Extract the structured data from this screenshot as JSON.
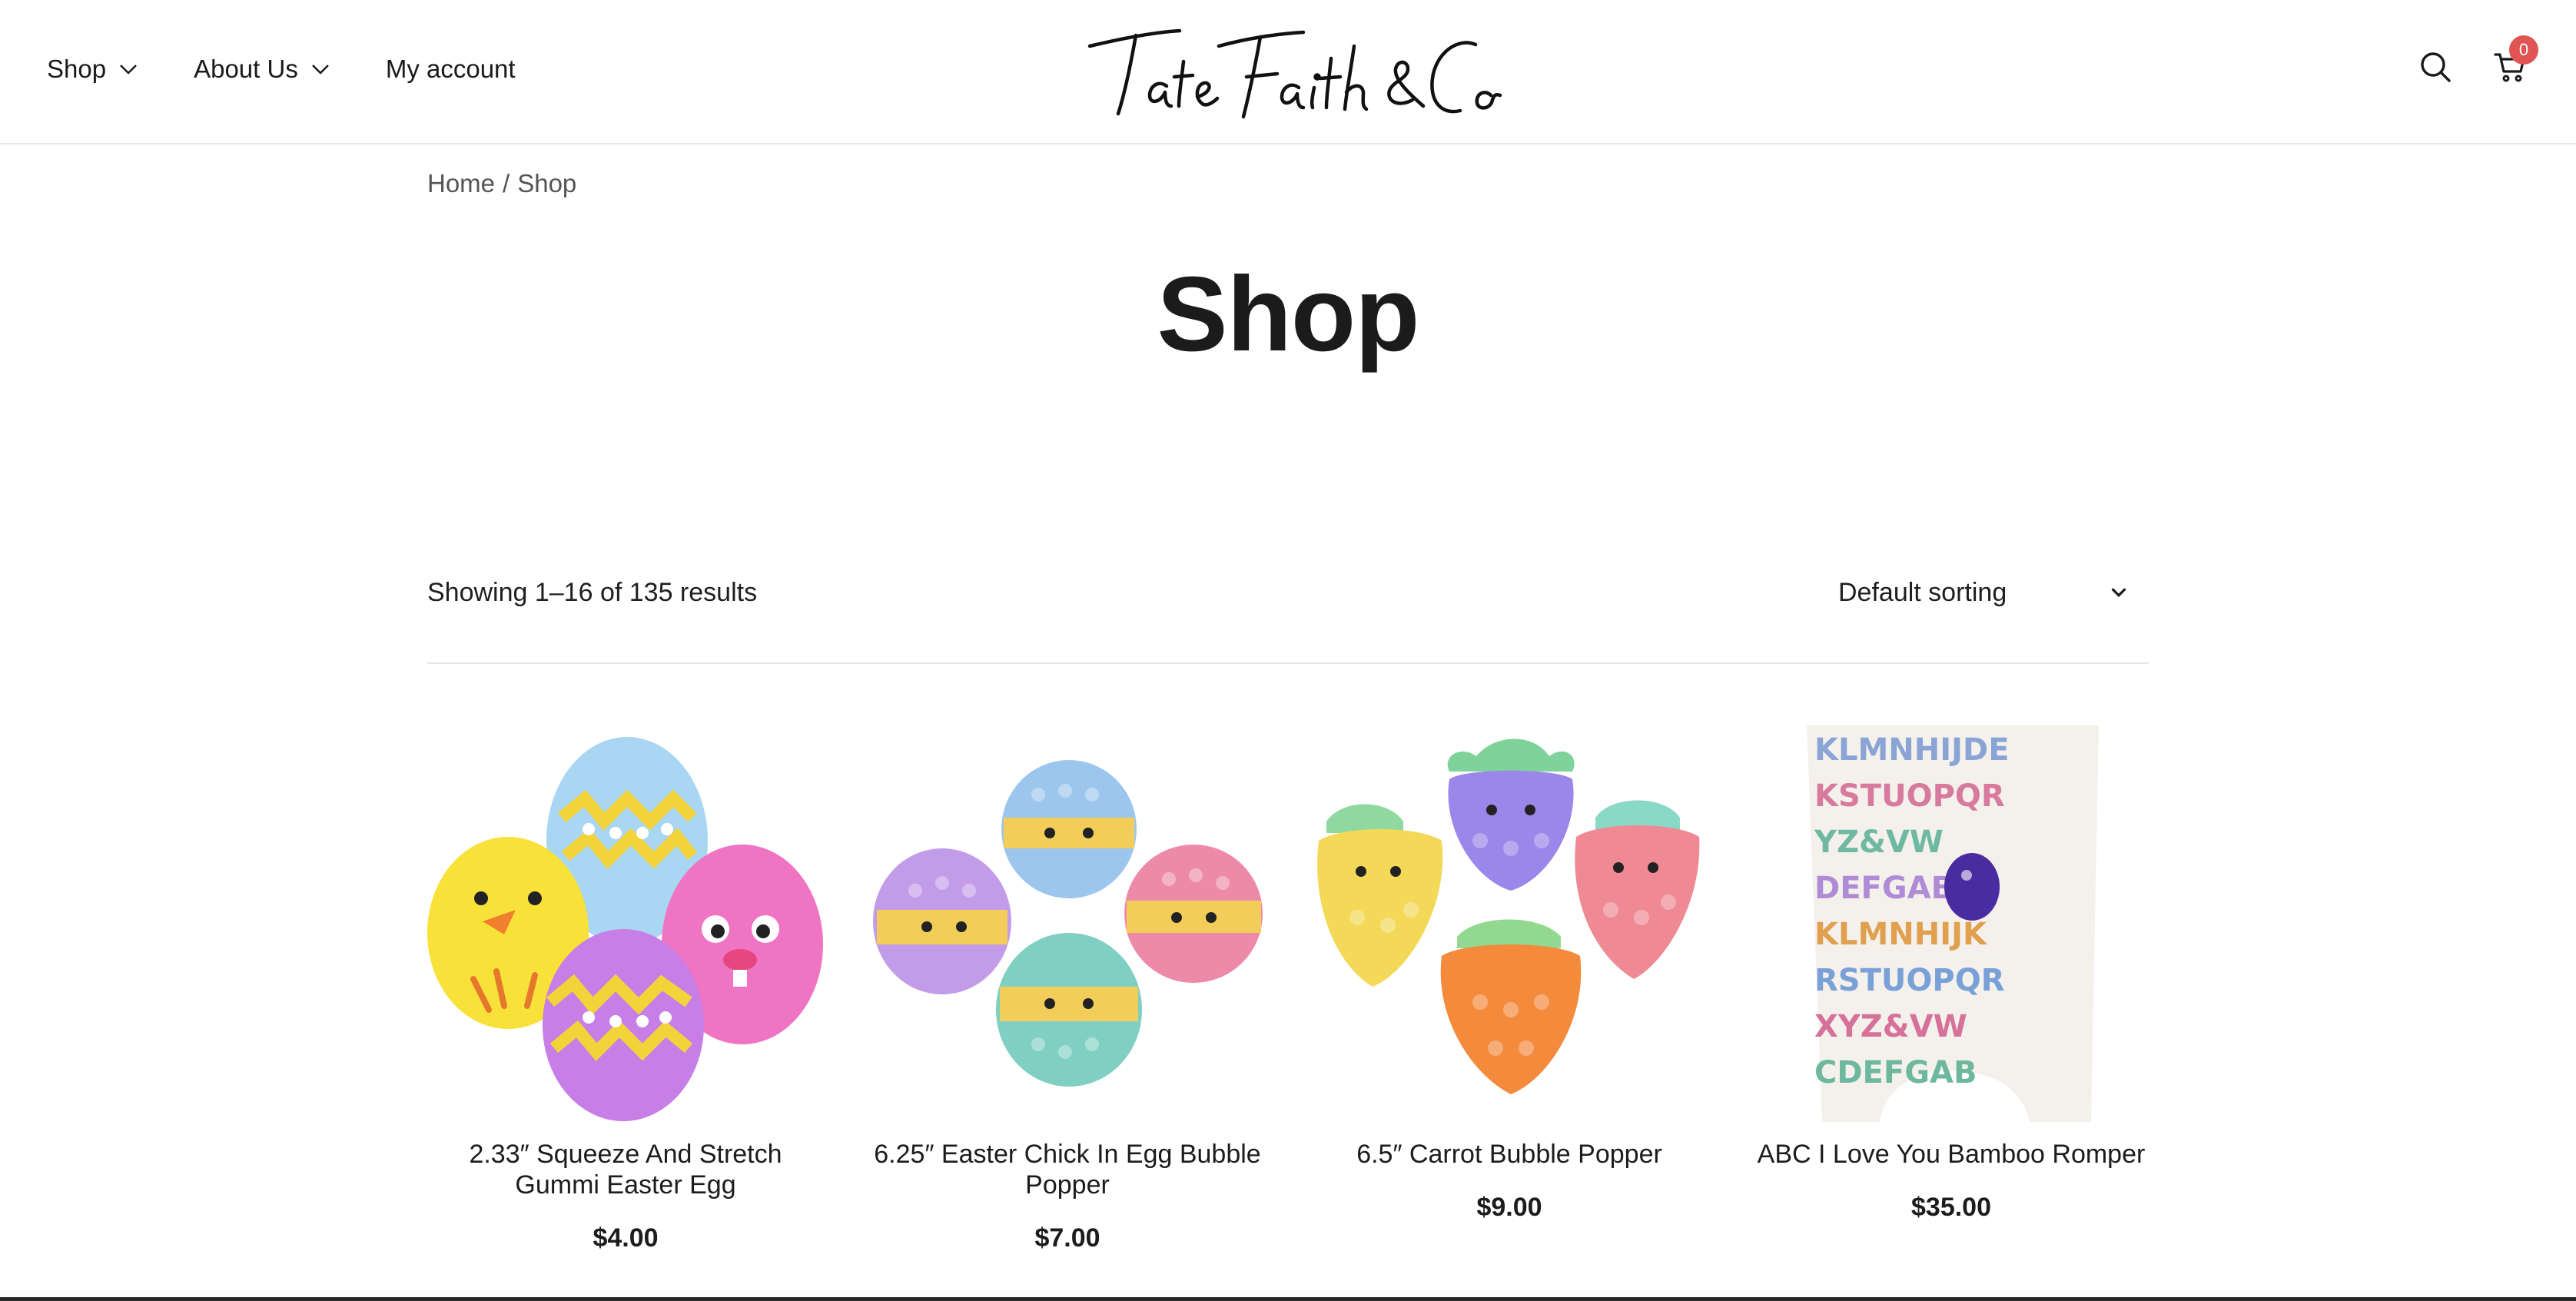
{
  "header": {
    "nav": [
      {
        "label": "Shop",
        "has_dropdown": true
      },
      {
        "label": "About Us",
        "has_dropdown": true
      },
      {
        "label": "My account",
        "has_dropdown": false
      }
    ],
    "logo_text": "Tate Faith & Co",
    "icons": [
      "search-icon",
      "cart-icon"
    ],
    "cart_count": "0",
    "badge_color": "#e05454"
  },
  "breadcrumb": {
    "home": "Home",
    "separator": "/",
    "current": "Shop"
  },
  "page_title": "Shop",
  "catalog": {
    "result_count": "Showing 1–16 of 135 results",
    "sorting": {
      "selected": "Default sorting"
    }
  },
  "products": [
    {
      "title": "2.33″ Squeeze And Stretch Gummi Easter Egg",
      "price": "$4.00"
    },
    {
      "title": "6.25″ Easter Chick In Egg Bubble Popper",
      "price": "$7.00"
    },
    {
      "title": "6.5″ Carrot Bubble Popper",
      "price": "$9.00"
    },
    {
      "title": "ABC I Love You Bamboo Romper",
      "price": "$35.00"
    }
  ]
}
